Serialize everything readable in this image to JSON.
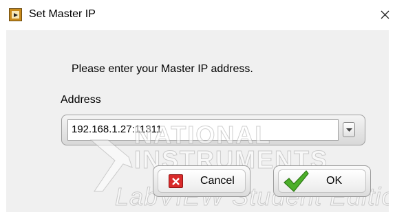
{
  "window": {
    "title": "Set Master IP",
    "app_icon": "labview-vi-icon",
    "close_icon": "close-icon"
  },
  "dialog": {
    "prompt": "Please enter your Master IP address.",
    "address_label": "Address",
    "address_value": "192.168.1.27:11311",
    "dropdown_icon": "chevron-down-icon"
  },
  "buttons": {
    "cancel_label": "Cancel",
    "cancel_icon": "red-x-icon",
    "ok_label": "OK",
    "ok_icon": "green-check-icon"
  },
  "watermark": {
    "line1": "NATIONAL",
    "line2": "INSTRUMENTS",
    "line3": "LabVIEW Student Edition"
  },
  "colors": {
    "cancel_icon": "#d92a2a",
    "ok_check": "#4caf2a",
    "panel_background": "#f0f0f0"
  }
}
